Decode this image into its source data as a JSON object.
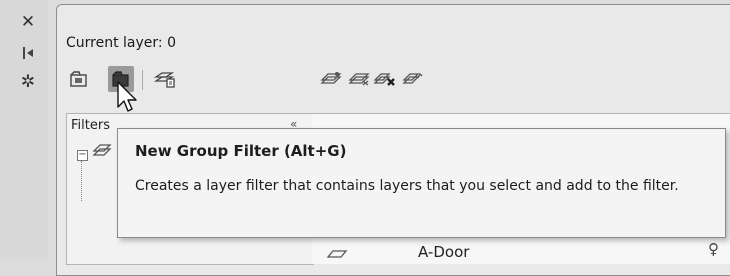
{
  "strip": {
    "close_glyph": "✕",
    "autohide_glyph": "⇥",
    "settings_glyph": "✲"
  },
  "palette": {
    "current_layer_text": "Current layer: 0",
    "toolbar": {
      "new_property_filter": "new-property-filter-icon",
      "new_group_filter": "new-group-filter-icon",
      "layer_states_manager": "layer-states-manager-icon",
      "new_layer": "new-layer-icon",
      "new_layer_vp_frozen": "new-layer-vp-frozen-icon",
      "delete_layer": "delete-layer-icon",
      "set_current": "set-current-icon"
    }
  },
  "filters": {
    "label": "Filters",
    "collapse_glyph": "«",
    "expander_glyph": "−"
  },
  "layer_list": {
    "rows": [
      {
        "name": "A-Door",
        "on_glyph": "♀"
      }
    ]
  },
  "tooltip": {
    "title": "New Group Filter (Alt+G)",
    "description": "Creates a layer filter that contains layers that you select and add to the filter."
  }
}
